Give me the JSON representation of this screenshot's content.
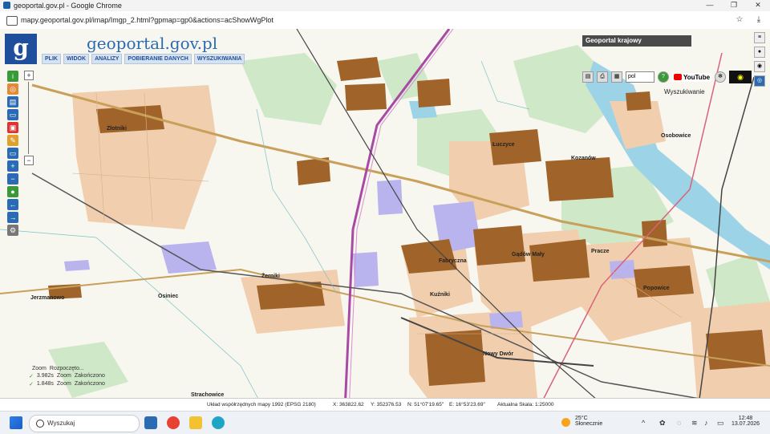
{
  "browser": {
    "window_title": "geoportal.gov.pl - Google Chrome",
    "url": "mapy.geoportal.gov.pl/imap/Imgp_2.html?gpmap=gp0&actions=acShowWgPlot"
  },
  "app": {
    "brand": "geoportal.gov.pl",
    "menu": [
      "PLIK",
      "WIDOK",
      "ANALIZY",
      "POBIERANIE DANYCH",
      "WYSZUKIWANIA"
    ],
    "panel_title": "Geoportal krajowy",
    "language": "pol",
    "youtube_label": "YouTube",
    "search_label": "Wyszukiwanie"
  },
  "places": [
    {
      "name": "Złotniki"
    },
    {
      "name": "Łuczyce"
    },
    {
      "name": "Kozanów"
    },
    {
      "name": "Osobowice"
    },
    {
      "name": "Fabryczna"
    },
    {
      "name": "Gądów Mały"
    },
    {
      "name": "Pracze"
    },
    {
      "name": "Żerniki"
    },
    {
      "name": "Kuźniki"
    },
    {
      "name": "Popowice"
    },
    {
      "name": "Jerzmanowo"
    },
    {
      "name": "Osiniec"
    },
    {
      "name": "Nowy Dwór"
    },
    {
      "name": "Strachowice"
    }
  ],
  "log": [
    {
      "time": "",
      "action": "Zoom",
      "status": "Rozpoczęto..."
    },
    {
      "time": "3.982s",
      "action": "Zoom",
      "status": "Zakończono"
    },
    {
      "time": "1.848s",
      "action": "Zoom",
      "status": "Zakończono"
    }
  ],
  "status": {
    "crs": "Układ współrzędnych mapy 1992 (EPSG 2180)",
    "x": "X: 363822.62",
    "y": "Y: 352376.53",
    "n": "N: 51°07'19.65\"",
    "e": "E: 16°53'23.69\"",
    "scale": "Aktualna Skala: 1:25000"
  },
  "taskbar": {
    "search_placeholder": "Wyszukaj",
    "temperature": "25°C",
    "weather": "Słonecznie",
    "time": "12:48",
    "date": "13.07.2026"
  },
  "colors": {
    "built_up": "#a0642a",
    "residential": "#f1cfae",
    "industrial": "#b9b3ee",
    "water": "#9dd3e6",
    "forest": "#cfe8c8",
    "accent": "#1f4e9c"
  }
}
